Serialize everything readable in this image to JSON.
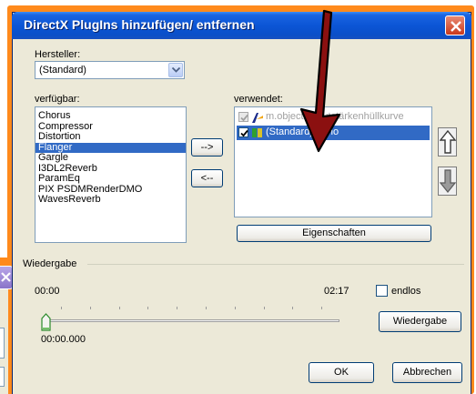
{
  "window": {
    "title": "DirectX PlugIns hinzufügen/ entfernen"
  },
  "manufacturer": {
    "label": "Hersteller:",
    "selected": "(Standard)"
  },
  "available": {
    "label": "verfügbar:",
    "items": [
      "Chorus",
      "Compressor",
      "Distortion",
      "Flanger",
      "Gargle",
      "I3DL2Reverb",
      "ParamEq",
      "PIX PSDMRenderDMO",
      "WavesReverb"
    ],
    "selected_index": 3
  },
  "used": {
    "label": "verwendet:",
    "items": [
      {
        "text": "m.objects Lautstärkenhüllkurve",
        "checked": true,
        "enabled": false
      },
      {
        "text": "(Standard) Echo",
        "checked": true,
        "enabled": true,
        "selected": true
      }
    ]
  },
  "buttons": {
    "move_right": "-->",
    "move_left": "<--",
    "properties": "Eigenschaften",
    "play": "Wiedergabe",
    "ok": "OK",
    "cancel": "Abbrechen"
  },
  "playback": {
    "group_label": "Wiedergabe",
    "start_time": "00:00",
    "end_time": "02:17",
    "loop_label": "endlos",
    "loop_checked": false,
    "position": "00:00.000",
    "position_fraction": 0
  },
  "colors": {
    "frame": "#ff8a1c",
    "titlebar": "#0b55d6",
    "selection": "#316ac5",
    "annotation_arrow": "#8b1010"
  },
  "icons": [
    "close-icon",
    "dropdown-arrow-icon",
    "move-up-icon",
    "move-down-icon",
    "plugin-icon",
    "annotation-arrow-icon"
  ]
}
